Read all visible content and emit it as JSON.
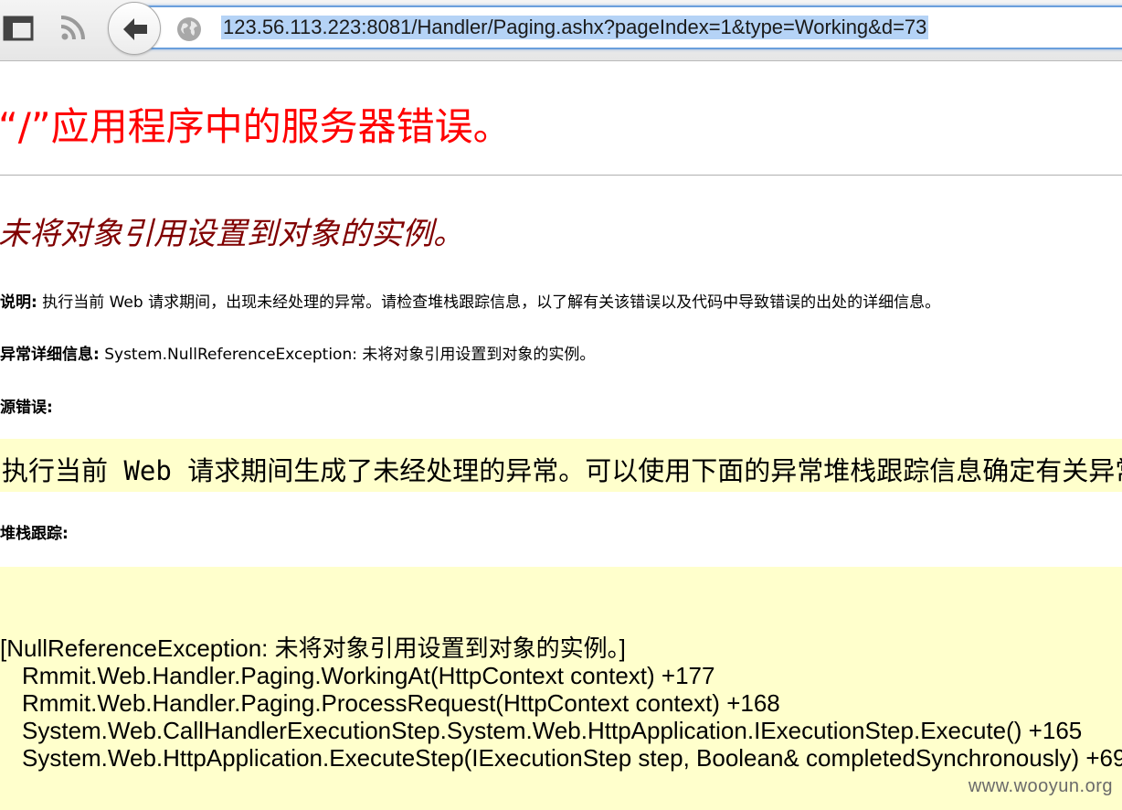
{
  "browser": {
    "url": "123.56.113.223:8081/Handler/Paging.ashx?pageIndex=1&type=Working&d=73",
    "icons": [
      "sidebar-icon",
      "rss-icon",
      "back-arrow-icon",
      "globe-icon"
    ]
  },
  "error_page": {
    "app_title": "“/”应用程序中的服务器错误。",
    "error_title": "未将对象引用设置到对象的实例。",
    "description_label": "说明:",
    "description_text": " 执行当前 Web 请求期间，出现未经处理的异常。请检查堆栈跟踪信息，以了解有关该错误以及代码中导致错误的出处的详细信息。",
    "exception_label": "异常详细信息:",
    "exception_text": " System.NullReferenceException: 未将对象引用设置到对象的实例。",
    "source_error_label": "源错误:",
    "source_error_text": "执行当前 Web 请求期间生成了未经处理的异常。可以使用下面的异常堆栈跟踪信息确定有关异常原因和发生位置的信息。",
    "stack_trace_label": "堆栈跟踪:",
    "stack_header": "[NullReferenceException: 未将对象引用设置到对象的实例。]",
    "stack_lines": [
      "Rmmit.Web.Handler.Paging.WorkingAt(HttpContext context) +177",
      "Rmmit.Web.Handler.Paging.ProcessRequest(HttpContext context) +168",
      "System.Web.CallHandlerExecutionStep.System.Web.HttpApplication.IExecutionStep.Execute() +165",
      "System.Web.HttpApplication.ExecuteStep(IExecutionStep step, Boolean& completedSynchronously) +69"
    ]
  },
  "watermark": "www.wooyun.org"
}
